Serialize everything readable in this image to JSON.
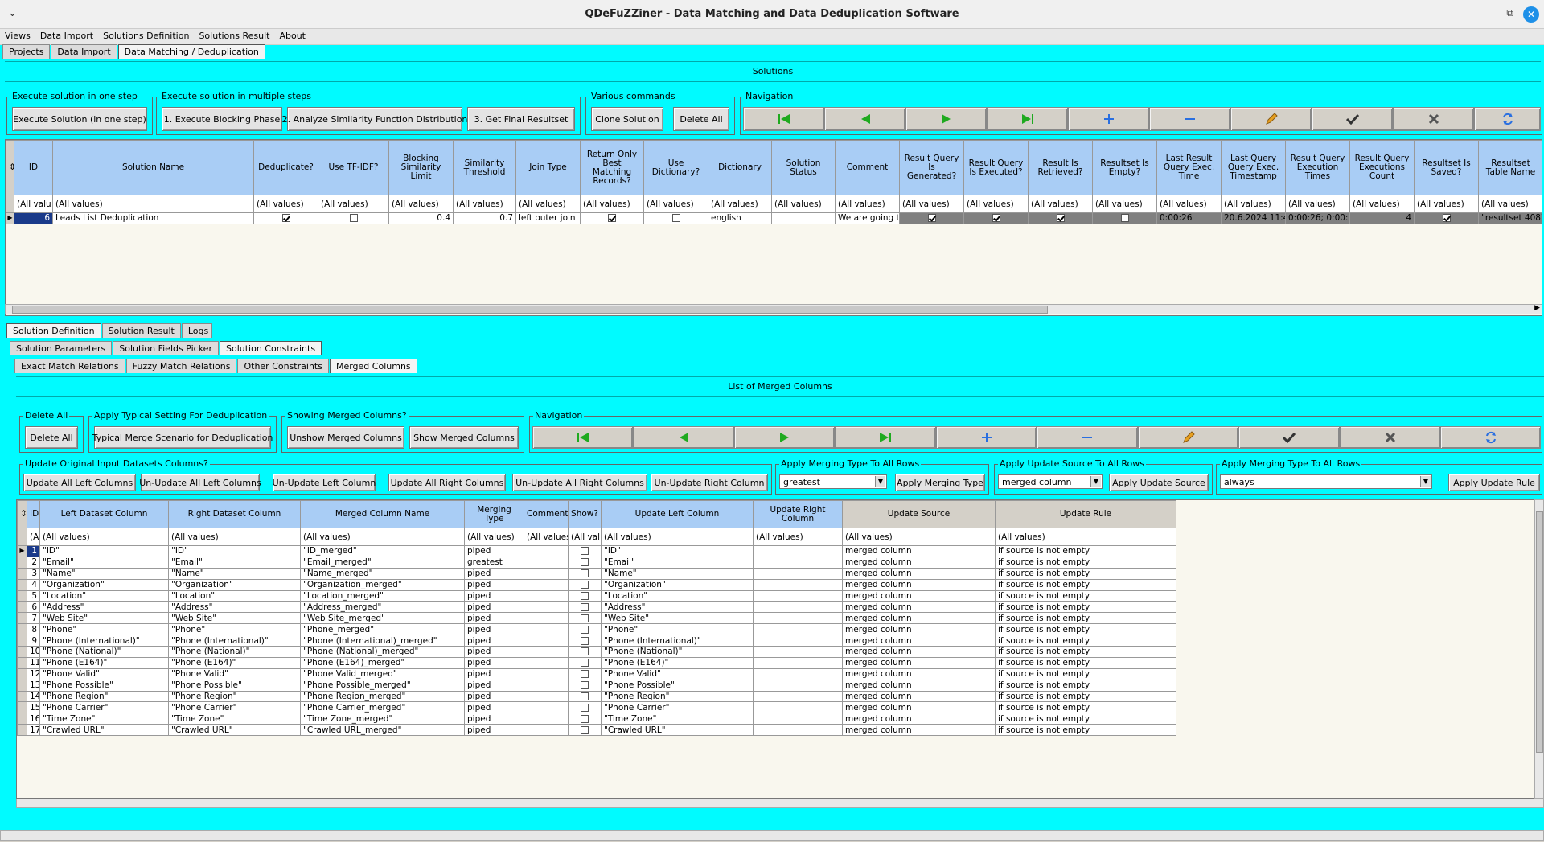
{
  "window": {
    "title": "QDeFuZZiner - Data Matching and Data Deduplication Software"
  },
  "menu": [
    "Views",
    "Data Import",
    "Solutions Definition",
    "Solutions Result",
    "About"
  ],
  "main_tabs": [
    "Projects",
    "Data Import",
    "Data Matching / Deduplication"
  ],
  "solutions": {
    "header": "Solutions",
    "groups": {
      "one_step": "Execute solution in one step",
      "multi_step": "Execute solution in multiple steps",
      "various": "Various commands",
      "nav": "Navigation"
    },
    "buttons": {
      "execute_one": "Execute Solution (in one step)",
      "blocking": "1. Execute Blocking Phase",
      "analyze": "2. Analyze Similarity Function Distribution",
      "final": "3. Get Final Resultset",
      "clone": "Clone Solution",
      "delete_all": "Delete All"
    },
    "columns": [
      "ID",
      "Solution Name",
      "Deduplicate?",
      "Use TF-IDF?",
      "Blocking Similarity Limit",
      "Similarity Threshold",
      "Join Type",
      "Return Only Best Matching Records?",
      "Use Dictionary?",
      "Dictionary",
      "Solution Status",
      "Comment",
      "Result Query Is Generated?",
      "Result Query Is Executed?",
      "Result Is Retrieved?",
      "Resultset Is Empty?",
      "Last Result Query Exec. Time",
      "Last Query Query Exec. Timestamp",
      "Result Query Execution Times",
      "Result Query Executions Count",
      "Resultset Is Saved?",
      "Resultset Table Name"
    ],
    "filters": [
      "(All valu",
      "(All values)",
      "(All values)",
      "(All values)",
      "(All values)",
      "(All values)",
      "(All values)",
      "(All values)",
      "(All values)",
      "(All values)",
      "(All values)",
      "(All values)",
      "(All values)",
      "(All values)",
      "(All values)",
      "(All values)",
      "(All values)",
      "(All values)",
      "(All values)",
      "(All values)",
      "(All values)",
      "(All values)"
    ],
    "row": {
      "id": "6",
      "name": "Leads List Deduplication",
      "deduplicate": true,
      "tfidf": false,
      "blocking": "0.4",
      "threshold": "0.7",
      "join": "left outer join",
      "best": true,
      "use_dict": false,
      "dictionary": "english",
      "status": "",
      "comment": "We are going tc",
      "generated": true,
      "executed": true,
      "retrieved": true,
      "empty": false,
      "exec_time": "0:00:26",
      "timestamp": "20.6.2024 11:4",
      "exec_times": "0:00:26; 0:00:2",
      "count": "4",
      "saved": true,
      "table": "\"resultset 4087"
    }
  },
  "lower_tabs": [
    "Solution Definition",
    "Solution Result",
    "Logs"
  ],
  "def_tabs": [
    "Solution Parameters",
    "Solution Fields Picker",
    "Solution Constraints"
  ],
  "constraint_tabs": [
    "Exact Match Relations",
    "Fuzzy Match Relations",
    "Other Constraints",
    "Merged Columns"
  ],
  "merged": {
    "header": "List of Merged Columns",
    "groups": {
      "delete_all": "Delete All",
      "typical": "Apply Typical Setting For Deduplication",
      "showing": "Showing Merged Columns?",
      "nav": "Navigation",
      "update_orig": "Update Original Input Datasets Columns?",
      "merge_type": "Apply Merging Type To All Rows",
      "update_source": "Apply Update Source To All Rows",
      "update_rule": "Apply Merging Type To All Rows"
    },
    "buttons": {
      "delete_all": "Delete All",
      "typical": "Typical Merge Scenario for Deduplication",
      "unshow": "Unshow Merged Columns",
      "show": "Show Merged Columns",
      "upd_all_left": "Update All Left Columns",
      "unupd_all_left": "Un-Update All Left Columns",
      "unupd_left": "Un-Update Left Column",
      "upd_all_right": "Update All Right Columns",
      "unupd_all_right": "Un-Update All Right Columns",
      "unupd_right": "Un-Update Right Column",
      "apply_merge": "Apply Merging Type",
      "apply_source": "Apply Update Source",
      "apply_rule": "Apply Update Rule"
    },
    "combos": {
      "merge": "greatest",
      "source": "merged column",
      "rule": "always"
    },
    "columns": [
      "ID",
      "Left Dataset Column",
      "Right Dataset Column",
      "Merged Column Name",
      "Merging Type",
      "Comment",
      "Show?",
      "Update Left Column",
      "Update Right Column",
      "Update Source",
      "Update Rule"
    ],
    "filters": [
      "(A",
      "(All values)",
      "(All values)",
      "(All values)",
      "(All values)",
      "(All values",
      "(All val",
      "(All values)",
      "(All values)",
      "(All values)",
      "(All values)"
    ],
    "rows": [
      [
        "1",
        "\"ID\"",
        "\"ID\"",
        "\"ID_merged\"",
        "piped",
        "",
        "",
        "\"ID\"",
        "",
        "merged column",
        "if source is not empty"
      ],
      [
        "2",
        "\"Email\"",
        "\"Email\"",
        "\"Email_merged\"",
        "greatest",
        "",
        "",
        "\"Email\"",
        "",
        "merged column",
        "if source is not empty"
      ],
      [
        "3",
        "\"Name\"",
        "\"Name\"",
        "\"Name_merged\"",
        "piped",
        "",
        "",
        "\"Name\"",
        "",
        "merged column",
        "if source is not empty"
      ],
      [
        "4",
        "\"Organization\"",
        "\"Organization\"",
        "\"Organization_merged\"",
        "piped",
        "",
        "",
        "\"Organization\"",
        "",
        "merged column",
        "if source is not empty"
      ],
      [
        "5",
        "\"Location\"",
        "\"Location\"",
        "\"Location_merged\"",
        "piped",
        "",
        "",
        "\"Location\"",
        "",
        "merged column",
        "if source is not empty"
      ],
      [
        "6",
        "\"Address\"",
        "\"Address\"",
        "\"Address_merged\"",
        "piped",
        "",
        "",
        "\"Address\"",
        "",
        "merged column",
        "if source is not empty"
      ],
      [
        "7",
        "\"Web Site\"",
        "\"Web Site\"",
        "\"Web Site_merged\"",
        "piped",
        "",
        "",
        "\"Web Site\"",
        "",
        "merged column",
        "if source is not empty"
      ],
      [
        "8",
        "\"Phone\"",
        "\"Phone\"",
        "\"Phone_merged\"",
        "piped",
        "",
        "",
        "\"Phone\"",
        "",
        "merged column",
        "if source is not empty"
      ],
      [
        "9",
        "\"Phone (International)\"",
        "\"Phone (International)\"",
        "\"Phone (International)_merged\"",
        "piped",
        "",
        "",
        "\"Phone (International)\"",
        "",
        "merged column",
        "if source is not empty"
      ],
      [
        "10",
        "\"Phone (National)\"",
        "\"Phone (National)\"",
        "\"Phone (National)_merged\"",
        "piped",
        "",
        "",
        "\"Phone (National)\"",
        "",
        "merged column",
        "if source is not empty"
      ],
      [
        "11",
        "\"Phone (E164)\"",
        "\"Phone (E164)\"",
        "\"Phone (E164)_merged\"",
        "piped",
        "",
        "",
        "\"Phone (E164)\"",
        "",
        "merged column",
        "if source is not empty"
      ],
      [
        "12",
        "\"Phone Valid\"",
        "\"Phone Valid\"",
        "\"Phone Valid_merged\"",
        "piped",
        "",
        "",
        "\"Phone Valid\"",
        "",
        "merged column",
        "if source is not empty"
      ],
      [
        "13",
        "\"Phone Possible\"",
        "\"Phone Possible\"",
        "\"Phone Possible_merged\"",
        "piped",
        "",
        "",
        "\"Phone Possible\"",
        "",
        "merged column",
        "if source is not empty"
      ],
      [
        "14",
        "\"Phone Region\"",
        "\"Phone Region\"",
        "\"Phone Region_merged\"",
        "piped",
        "",
        "",
        "\"Phone Region\"",
        "",
        "merged column",
        "if source is not empty"
      ],
      [
        "15",
        "\"Phone Carrier\"",
        "\"Phone Carrier\"",
        "\"Phone Carrier_merged\"",
        "piped",
        "",
        "",
        "\"Phone Carrier\"",
        "",
        "merged column",
        "if source is not empty"
      ],
      [
        "16",
        "\"Time Zone\"",
        "\"Time Zone\"",
        "\"Time Zone_merged\"",
        "piped",
        "",
        "",
        "\"Time Zone\"",
        "",
        "merged column",
        "if source is not empty"
      ],
      [
        "17",
        "\"Crawled URL\"",
        "\"Crawled URL\"",
        "\"Crawled URL_merged\"",
        "piped",
        "",
        "",
        "\"Crawled URL\"",
        "",
        "merged column",
        "if source is not empty"
      ]
    ]
  },
  "colors": {
    "panel": "#00fbff",
    "header": "#a9cdf5",
    "nav_green": "#1faa1f",
    "nav_blue": "#2a6fe0"
  }
}
